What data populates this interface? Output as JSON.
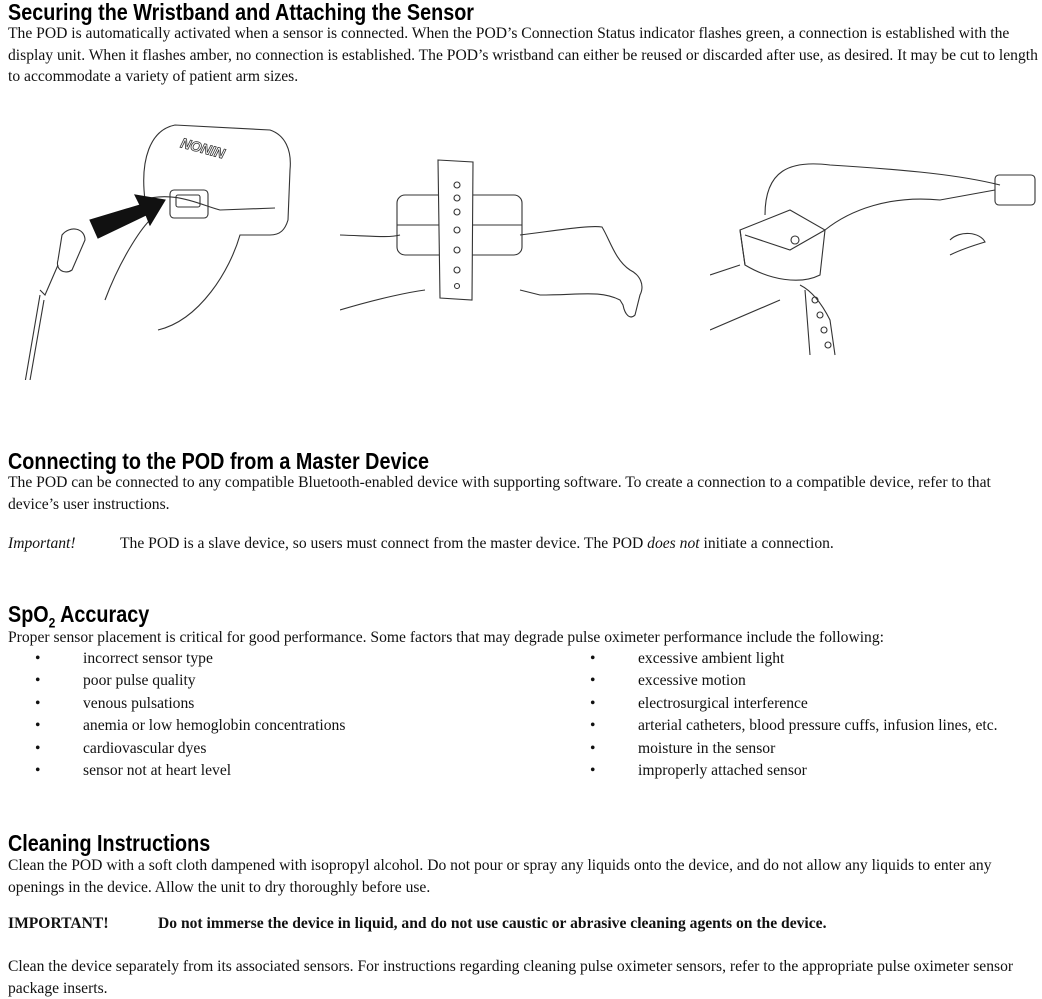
{
  "sections": {
    "wristband": {
      "title": "Securing the Wristband and Attaching the Sensor",
      "body": "The POD is automatically activated when a sensor is connected. When the POD’s Connection Status indicator flashes green, a connection is established with the display unit. When it flashes amber, no connection is established. The POD’s wristband can either be reused or discarded after use, as desired. It may be cut to length to accommodate a variety of patient arm sizes.",
      "logo_text": "NONIN"
    },
    "connecting": {
      "title": "Connecting to the POD from a Master Device",
      "body": "The POD can be connected to any compatible Bluetooth-enabled device with supporting software. To create a connection to a compatible device, refer to that device’s user instructions.",
      "important_label": "Important!",
      "important_text_before": "The POD is a slave device, so users must connect from the master device. The POD ",
      "important_emph": "does not",
      "important_text_after": " initiate a connection."
    },
    "spo2": {
      "title_prefix": "SpO",
      "title_sub": "2",
      "title_suffix": " Accuracy",
      "body": "Proper sensor placement is critical for good performance. Some factors that may degrade pulse oximeter performance include the following:",
      "left_items": [
        "incorrect sensor type",
        "poor pulse quality",
        "venous pulsations",
        "anemia or low hemoglobin concentrations",
        "cardiovascular dyes",
        "sensor not at heart level"
      ],
      "right_items": [
        "excessive ambient light",
        "excessive motion",
        "electrosurgical interference",
        "arterial catheters, blood pressure cuffs, infusion lines, etc.",
        "moisture in the sensor",
        "improperly attached sensor"
      ]
    },
    "cleaning": {
      "title": "Cleaning Instructions",
      "body": "Clean the POD with a soft cloth dampened with isopropyl alcohol. Do not pour or spray any liquids onto the device, and do not allow any liquids to enter any openings in the device. Allow the unit to dry thoroughly before use.",
      "important_label": "IMPORTANT!",
      "important_text": "Do not immerse the device in liquid, and do not use caustic or abrasive cleaning agents on the device.",
      "body2": "Clean the device separately from its associated sensors.  For instructions regarding cleaning pulse oximeter sensors, refer to the appropriate pulse oximeter sensor package inserts."
    }
  }
}
